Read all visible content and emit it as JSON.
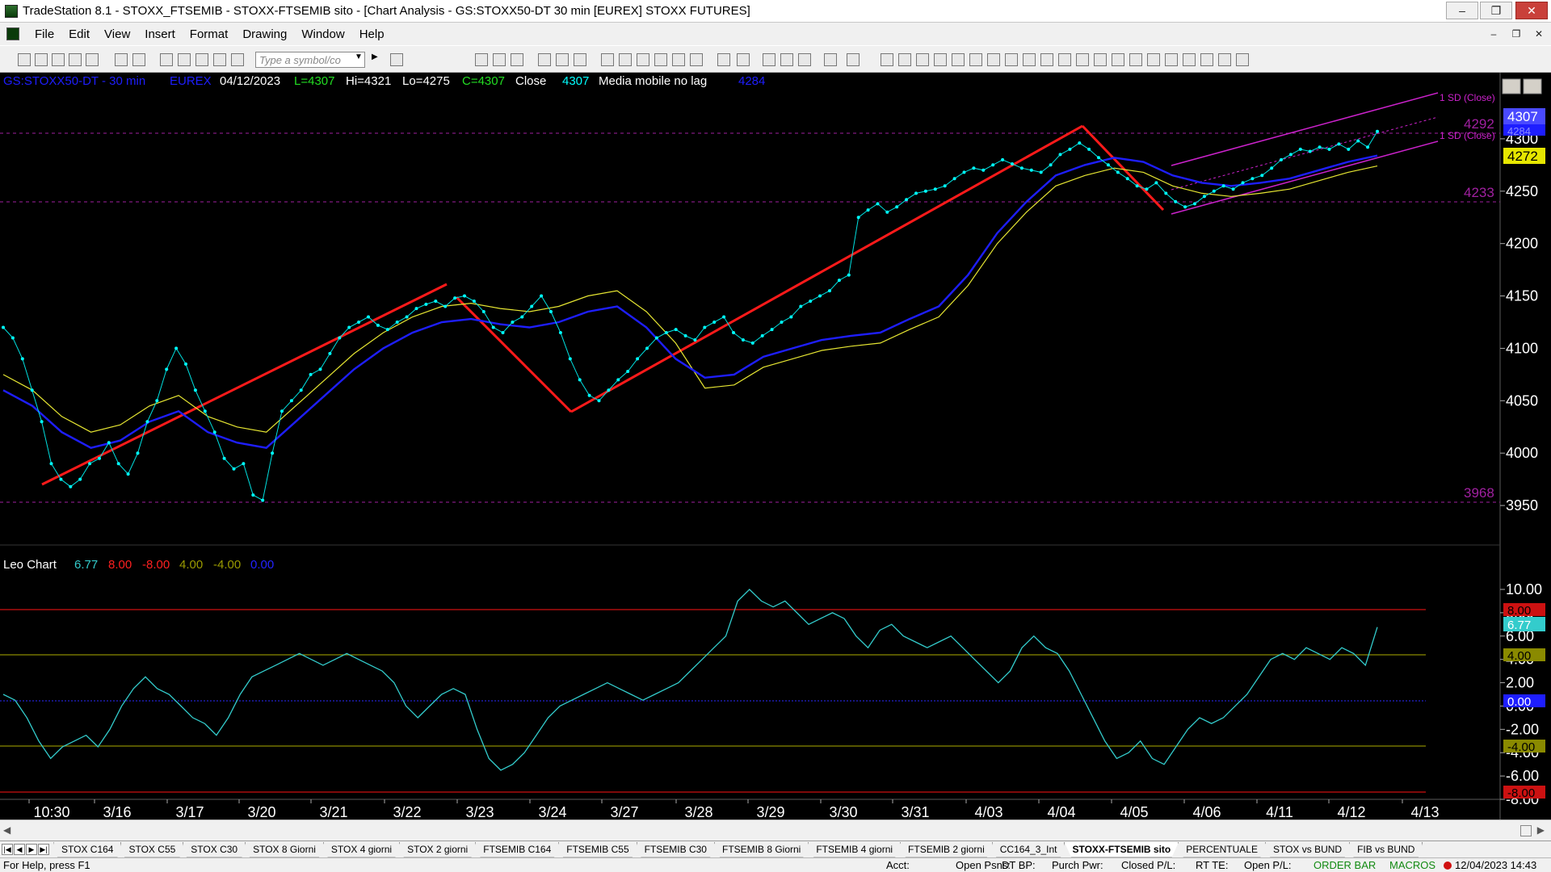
{
  "window": {
    "title": "TradeStation 8.1 - STOXX_FTSEMIB - STOXX-FTSEMIB sito - [Chart Analysis - GS:STOXX50-DT  30 min  [EUREX] STOXX FUTURES]"
  },
  "menu": [
    "File",
    "Edit",
    "View",
    "Insert",
    "Format",
    "Drawing",
    "Window",
    "Help"
  ],
  "toolbar": {
    "symbol_placeholder": "Type a symbol/co"
  },
  "price_header": {
    "symbol": "GS:STOXX50-DT - 30 min",
    "exchange": "EUREX",
    "date": "04/12/2023",
    "last": "L=4307",
    "high": "Hi=4321",
    "low": "Lo=4275",
    "close": "C=4307",
    "close_label": "Close",
    "close_value": "4307",
    "ma_label": "Media mobile no lag",
    "ma_value": "4284"
  },
  "leo_header": {
    "label": "Leo Chart",
    "v1": "6.77",
    "v2": "8.00",
    "v3": "-8.00",
    "v4": "4.00",
    "v5": "-4.00",
    "v6": "0.00"
  },
  "channel_labels": {
    "upper": "1 SD (Close)",
    "lower": "1 SD (Close)"
  },
  "level_labels": {
    "l4292": "4292",
    "l4233": "4233",
    "l3968": "3968"
  },
  "price_badges": {
    "last": "4307",
    "ma_hidden": "4284",
    "ma_yellow": "4272"
  },
  "leo_badges": {
    "b800": "8.00",
    "b677": "6.77",
    "b400": "4.00",
    "b000": "0.00",
    "bm400": "-4.00",
    "bm800": "-8.00"
  },
  "colors": {
    "price_dots": "#00ffff",
    "ma_blue": "#1e1eff",
    "ma_yellow": "#e6e632",
    "trendline": "#ff1a1a",
    "channel": "#cc22cc",
    "level": "#a020a0",
    "leo_line": "#33cccc"
  },
  "chart_data": [
    {
      "type": "line",
      "title": "GS:STOXX50-DT - 30 min",
      "ylim": [
        3920,
        4340
      ],
      "y_ticks": [
        "4300",
        "4250",
        "4200",
        "4150",
        "4100",
        "4050",
        "4000",
        "3950"
      ],
      "x_ticks": [
        "10:30",
        "3/16",
        "3/17",
        "3/20",
        "3/21",
        "3/22",
        "3/23",
        "3/24",
        "3/27",
        "3/28",
        "3/29",
        "3/30",
        "3/31",
        "4/03",
        "4/04",
        "4/05",
        "4/06",
        "4/11",
        "4/12",
        "4/13"
      ],
      "series": [
        {
          "name": "Close",
          "values": [
            4120,
            4110,
            4090,
            4060,
            4030,
            3990,
            3975,
            3968,
            3975,
            3990,
            3995,
            4010,
            3990,
            3980,
            4000,
            4030,
            4050,
            4080,
            4100,
            4085,
            4060,
            4040,
            4020,
            3995,
            3985,
            3990,
            3960,
            3955,
            4000,
            4040,
            4050,
            4060,
            4075,
            4080,
            4095,
            4110,
            4120,
            4125,
            4130,
            4122,
            4118,
            4125,
            4130,
            4138,
            4142,
            4145,
            4140,
            4148,
            4150,
            4145,
            4135,
            4120,
            4115,
            4125,
            4130,
            4140,
            4150,
            4135,
            4115,
            4090,
            4070,
            4055,
            4050,
            4060,
            4070,
            4078,
            4090,
            4100,
            4110,
            4115,
            4118,
            4112,
            4108,
            4120,
            4125,
            4130,
            4115,
            4108,
            4105,
            4112,
            4118,
            4125,
            4130,
            4140,
            4145,
            4150,
            4155,
            4165,
            4170,
            4225,
            4232,
            4238,
            4230,
            4235,
            4242,
            4248,
            4250,
            4252,
            4255,
            4262,
            4268,
            4272,
            4270,
            4275,
            4280,
            4276,
            4272,
            4270,
            4268,
            4275,
            4285,
            4290,
            4296,
            4290,
            4282,
            4275,
            4268,
            4262,
            4255,
            4252,
            4258,
            4248,
            4240,
            4235,
            4238,
            4245,
            4250,
            4255,
            4252,
            4258,
            4262,
            4265,
            4272,
            4280,
            4285,
            4290,
            4288,
            4292,
            4290,
            4295,
            4290,
            4298,
            4292,
            4307
          ]
        },
        {
          "name": "Media mobile no lag",
          "values": [
            4060,
            4045,
            4020,
            4005,
            4012,
            4030,
            4040,
            4020,
            4010,
            4005,
            4030,
            4055,
            4080,
            4100,
            4115,
            4125,
            4128,
            4123,
            4120,
            4125,
            4135,
            4140,
            4120,
            4090,
            4072,
            4075,
            4092,
            4100,
            4108,
            4112,
            4115,
            4128,
            4140,
            4170,
            4210,
            4240,
            4265,
            4275,
            4282,
            4278,
            4265,
            4258,
            4255,
            4258,
            4262,
            4270,
            4278,
            4284
          ]
        }
      ]
    },
    {
      "type": "line",
      "title": "Leo Chart",
      "ylim": [
        -8,
        10
      ],
      "y_ticks": [
        "10.00",
        "8.00",
        "6.00",
        "4.00",
        "2.00",
        "0.00",
        "-2.00",
        "-4.00",
        "-6.00",
        "-8.00"
      ],
      "levels": [
        8,
        4,
        0,
        -4,
        -8
      ],
      "series": [
        {
          "name": "Leo Chart",
          "values": [
            1,
            0.5,
            -1,
            -3,
            -4.5,
            -3.5,
            -3,
            -2.5,
            -3.5,
            -2,
            0,
            1.5,
            2.5,
            1.5,
            1,
            0,
            -1,
            -1.5,
            -2.5,
            -1,
            1,
            2.5,
            3,
            3.5,
            4,
            4.5,
            4,
            3.5,
            4,
            4.5,
            4,
            3.5,
            3,
            2,
            0,
            -1,
            0,
            1,
            1.5,
            1,
            -2,
            -4.5,
            -5.5,
            -5,
            -4,
            -2.5,
            -1,
            0,
            0.5,
            1,
            1.5,
            2,
            1.5,
            1,
            0.5,
            1,
            1.5,
            2,
            3,
            4,
            5,
            6,
            9,
            10,
            9,
            8.5,
            9,
            8,
            7,
            7.5,
            8,
            7.5,
            6,
            5,
            6.5,
            7,
            6,
            5.5,
            5,
            5.5,
            6,
            5,
            4,
            3,
            2,
            3,
            5,
            6,
            5,
            4.5,
            3,
            1,
            -1,
            -3,
            -4.5,
            -4,
            -3,
            -4.5,
            -5,
            -3.5,
            -2,
            -1,
            -1.5,
            -1,
            0,
            1,
            2.5,
            4,
            4.5,
            4,
            5,
            4.5,
            4,
            5,
            4.5,
            3.5,
            6.77
          ]
        }
      ]
    }
  ]
}
